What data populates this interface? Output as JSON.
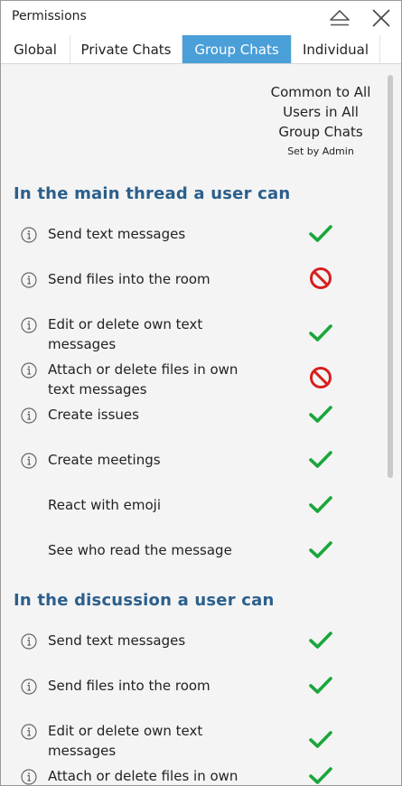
{
  "window": {
    "title": "Permissions"
  },
  "icons": {
    "eject": "eject-icon",
    "close": "close-icon",
    "info": "info-circle-icon",
    "allowed": "check-icon",
    "denied": "prohibited-icon"
  },
  "colors": {
    "active_tab": "#4a9fd8",
    "section_heading": "#2b5f8c",
    "allowed": "#1aa63b",
    "denied": "#d81e1e"
  },
  "tabs": [
    {
      "label": "Global",
      "active": false
    },
    {
      "label": "Private Chats",
      "active": false
    },
    {
      "label": "Group Chats",
      "active": true
    },
    {
      "label": "Individual",
      "active": false
    }
  ],
  "column_header": {
    "title_line1": "Common to All",
    "title_line2": "Users in All",
    "title_line3": "Group Chats",
    "subtitle": "Set by Admin"
  },
  "sections": [
    {
      "heading": "In the main thread a user can",
      "rows": [
        {
          "line1": "Send text messages",
          "line2": "",
          "info": true,
          "allowed": true
        },
        {
          "line1": "Send files into the room",
          "line2": "",
          "info": true,
          "allowed": false
        },
        {
          "line1": "Edit or delete own text",
          "line2": "messages",
          "info": true,
          "allowed": true
        },
        {
          "line1": "Attach or delete files in own",
          "line2": "text messages",
          "info": true,
          "allowed": false
        },
        {
          "line1": "Create issues",
          "line2": "",
          "info": true,
          "allowed": true
        },
        {
          "line1": "Create meetings",
          "line2": "",
          "info": true,
          "allowed": true
        },
        {
          "line1": "React with emoji",
          "line2": "",
          "info": false,
          "allowed": true
        },
        {
          "line1": "See who read the message",
          "line2": "",
          "info": false,
          "allowed": true
        }
      ]
    },
    {
      "heading": "In the discussion a user can",
      "rows": [
        {
          "line1": "Send text messages",
          "line2": "",
          "info": true,
          "allowed": true
        },
        {
          "line1": "Send files into the room",
          "line2": "",
          "info": true,
          "allowed": true
        },
        {
          "line1": "Edit or delete own text",
          "line2": "messages",
          "info": true,
          "allowed": true
        },
        {
          "line1": "Attach or delete files in own",
          "line2": "",
          "info": true,
          "allowed": true
        }
      ]
    }
  ]
}
